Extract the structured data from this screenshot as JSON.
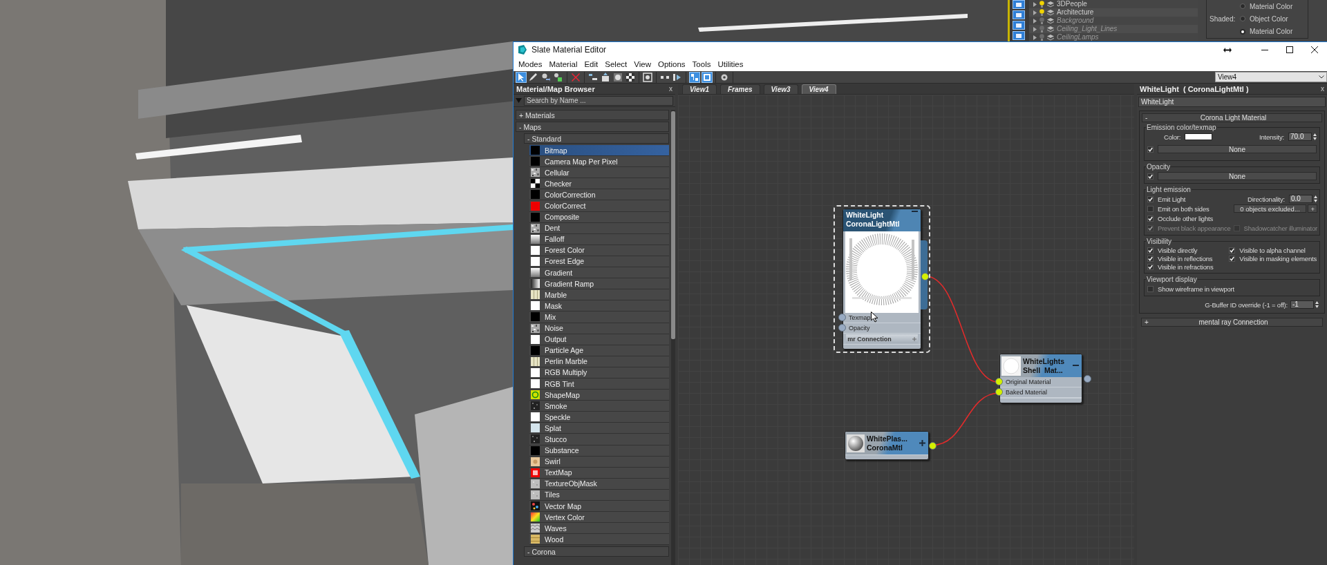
{
  "scene_explorer": {
    "layers": [
      {
        "name": "3DPeople",
        "on": true
      },
      {
        "name": "Architecture",
        "on": true
      },
      {
        "name": "Background",
        "on": false
      },
      {
        "name": "Ceiling_Light_Lines",
        "on": false
      },
      {
        "name": "CeilingLamps",
        "on": false
      }
    ]
  },
  "display_panel": {
    "top_option": {
      "label": "Material Color",
      "selected": false
    },
    "shaded_label": "Shaded:",
    "options": [
      {
        "label": "Object Color",
        "selected": false
      },
      {
        "label": "Material Color",
        "selected": true
      }
    ]
  },
  "editor": {
    "title": "Slate Material Editor",
    "menu": [
      "Modes",
      "Material",
      "Edit",
      "Select",
      "View",
      "Options",
      "Tools",
      "Utilities"
    ],
    "toolbar_groups": [
      {
        "tools": [
          {
            "kind": "select",
            "selected": true
          },
          {
            "kind": "eyedropper",
            "selected": false
          },
          {
            "kind": "put",
            "selected": false
          },
          {
            "kind": "assign",
            "selected": false
          }
        ]
      },
      {
        "tools": [
          {
            "kind": "delete",
            "selected": false
          }
        ]
      },
      {
        "tools": [
          {
            "kind": "children",
            "selected": false
          },
          {
            "kind": "export",
            "selected": false
          },
          {
            "kind": "background",
            "selected": false
          },
          {
            "kind": "checker",
            "selected": false
          }
        ]
      },
      {
        "tools": [
          {
            "kind": "preview",
            "selected": false
          }
        ]
      },
      {
        "tools": [
          {
            "kind": "dots",
            "selected": false
          },
          {
            "kind": "arrange",
            "selected": false
          }
        ]
      },
      {
        "tools": [
          {
            "kind": "nodes",
            "selected": true
          },
          {
            "kind": "panel",
            "selected": true
          }
        ]
      },
      {
        "tools": [
          {
            "kind": "options",
            "selected": false
          }
        ]
      }
    ],
    "view_select": {
      "value": "View4"
    },
    "browser": {
      "title": "Material/Map Browser",
      "close": "x",
      "search": {
        "placeholder": "Search by Name ..."
      },
      "sections": [
        {
          "label": "+ Materials"
        },
        {
          "label": "- Maps",
          "children": [
            {
              "label": "- Standard",
              "items": [
                {
                  "label": "Bitmap",
                  "kind": "black",
                  "selected": true
                },
                {
                  "label": "Camera Map Per Pixel",
                  "kind": "black",
                  "selected": false
                },
                {
                  "label": "Cellular",
                  "kind": "noise",
                  "selected": false
                },
                {
                  "label": "Checker",
                  "kind": "checker",
                  "selected": false
                },
                {
                  "label": "ColorCorrection",
                  "kind": "black",
                  "selected": false
                },
                {
                  "label": "ColorCorrect",
                  "kind": "red",
                  "selected": false
                },
                {
                  "label": "Composite",
                  "kind": "black",
                  "selected": false
                },
                {
                  "label": "Dent",
                  "kind": "noise",
                  "selected": false
                },
                {
                  "label": "Falloff",
                  "kind": "gradient",
                  "selected": false
                },
                {
                  "label": "Forest Color",
                  "kind": "white",
                  "selected": false
                },
                {
                  "label": "Forest Edge",
                  "kind": "white",
                  "selected": false
                },
                {
                  "label": "Gradient",
                  "kind": "gradient",
                  "selected": false
                },
                {
                  "label": "Gradient Ramp",
                  "kind": "ramp",
                  "selected": false
                },
                {
                  "label": "Marble",
                  "kind": "marble",
                  "selected": false
                },
                {
                  "label": "Mask",
                  "kind": "white",
                  "selected": false
                },
                {
                  "label": "Mix",
                  "kind": "black",
                  "selected": false
                },
                {
                  "label": "Noise",
                  "kind": "noise",
                  "selected": false
                },
                {
                  "label": "Output",
                  "kind": "white",
                  "selected": false
                },
                {
                  "label": "Particle Age",
                  "kind": "black",
                  "selected": false
                },
                {
                  "label": "Perlin Marble",
                  "kind": "marble",
                  "selected": false
                },
                {
                  "label": "RGB Multiply",
                  "kind": "white",
                  "selected": false
                },
                {
                  "label": "RGB Tint",
                  "kind": "white",
                  "selected": false
                },
                {
                  "label": "ShapeMap",
                  "kind": "spiral",
                  "selected": false
                },
                {
                  "label": "Smoke",
                  "kind": "dark-noise",
                  "selected": false
                },
                {
                  "label": "Speckle",
                  "kind": "white",
                  "selected": false
                },
                {
                  "label": "Splat",
                  "kind": "pale",
                  "selected": false
                },
                {
                  "label": "Stucco",
                  "kind": "dark-noise",
                  "selected": false
                },
                {
                  "label": "Substance",
                  "kind": "black",
                  "selected": false
                },
                {
                  "label": "Swirl",
                  "kind": "swirl",
                  "selected": false
                },
                {
                  "label": "TextMap",
                  "kind": "text",
                  "selected": false
                },
                {
                  "label": "TextureObjMask",
                  "kind": "grey",
                  "selected": false
                },
                {
                  "label": "Tiles",
                  "kind": "grey",
                  "selected": false
                },
                {
                  "label": "Vector Map",
                  "kind": "vector",
                  "selected": false
                },
                {
                  "label": "Vertex Color",
                  "kind": "vertex",
                  "selected": false
                },
                {
                  "label": "Waves",
                  "kind": "waves",
                  "selected": false
                },
                {
                  "label": "Wood",
                  "kind": "wood",
                  "selected": false
                }
              ]
            },
            {
              "label": "- Corona"
            }
          ]
        }
      ]
    },
    "views": {
      "tabs": [
        {
          "label": "View1",
          "selected": false
        },
        {
          "label": "Frames",
          "selected": false
        },
        {
          "label": "View3",
          "selected": false
        },
        {
          "label": "View4",
          "selected": true
        }
      ],
      "nodes": [
        {
          "kind": "preview",
          "title": "WhiteLight",
          "subtitle": "CoronaLightMtl",
          "expanded": true,
          "selected": true,
          "output_connected": true,
          "slots": [
            {
              "label": "Texmap",
              "connected": false
            },
            {
              "label": "Opacity",
              "connected": false
            }
          ],
          "footer": "mr Connection"
        },
        {
          "kind": "compact",
          "thumbnail": {
            "kind": "glow"
          },
          "title": "WhiteLights",
          "subtitle": "Shell  Mat...",
          "expanded": true,
          "selected": false,
          "output_connected": false,
          "slots": [
            {
              "label": "Original Material",
              "connected": true
            },
            {
              "label": "Baked Material",
              "connected": true
            }
          ]
        },
        {
          "kind": "collapsed",
          "thumbnail": {
            "kind": "sphere"
          },
          "title": "WhitePlas...",
          "subtitle": "CoronaMtl",
          "expanded": false,
          "selected": false,
          "output_connected": true
        }
      ]
    },
    "inspector": {
      "title": "WhiteLight  ( CoronaLightMtl )",
      "close": "x",
      "name": {
        "value": "WhiteLight"
      },
      "rollout": {
        "toggle": "-",
        "title": "Corona Light Material",
        "emission": {
          "legend": "Emission color/texmap",
          "color_label": "Color:",
          "intensity_label": "Intensity:",
          "intensity": "70.0",
          "map": {
            "checked": true,
            "label": "None"
          }
        },
        "opacity": {
          "legend": "Opacity",
          "map": {
            "checked": true,
            "label": "None"
          }
        },
        "light_emission": {
          "legend": "Light emission",
          "checks": [
            {
              "label": "Emit Light",
              "checked": true,
              "disabled": false
            },
            {
              "label": "Emit on both sides",
              "checked": false,
              "disabled": false
            },
            {
              "label": "Occlude other lights",
              "checked": true,
              "disabled": false
            },
            {
              "label": "Prevent black appearance",
              "checked": true,
              "disabled": true
            }
          ],
          "directionality_label": "Directionality:",
          "directionality": "0.0",
          "excluded": "0 objects excluded...",
          "add": "+",
          "shadowcatcher": {
            "label": "Shadowcatcher illuminator",
            "checked": false,
            "disabled": true
          }
        },
        "visibility": {
          "legend": "Visibility",
          "checks": [
            {
              "label": "Visible directly",
              "checked": true
            },
            {
              "label": "Visible to alpha channel",
              "checked": true
            },
            {
              "label": "Visible in reflections",
              "checked": true
            },
            {
              "label": "Visible in masking elements",
              "checked": true
            },
            {
              "label": "Visible in refractions",
              "checked": true
            }
          ]
        },
        "viewport": {
          "legend": "Viewport display",
          "checks": [
            {
              "label": "Show wireframe in viewport",
              "checked": false
            }
          ]
        },
        "gbuffer": {
          "label": "G-Buffer ID override (-1 = off):",
          "value": "-1"
        }
      },
      "collapsed_rollouts": [
        {
          "toggle": "+",
          "title": "mental ray Connection"
        }
      ]
    }
  }
}
